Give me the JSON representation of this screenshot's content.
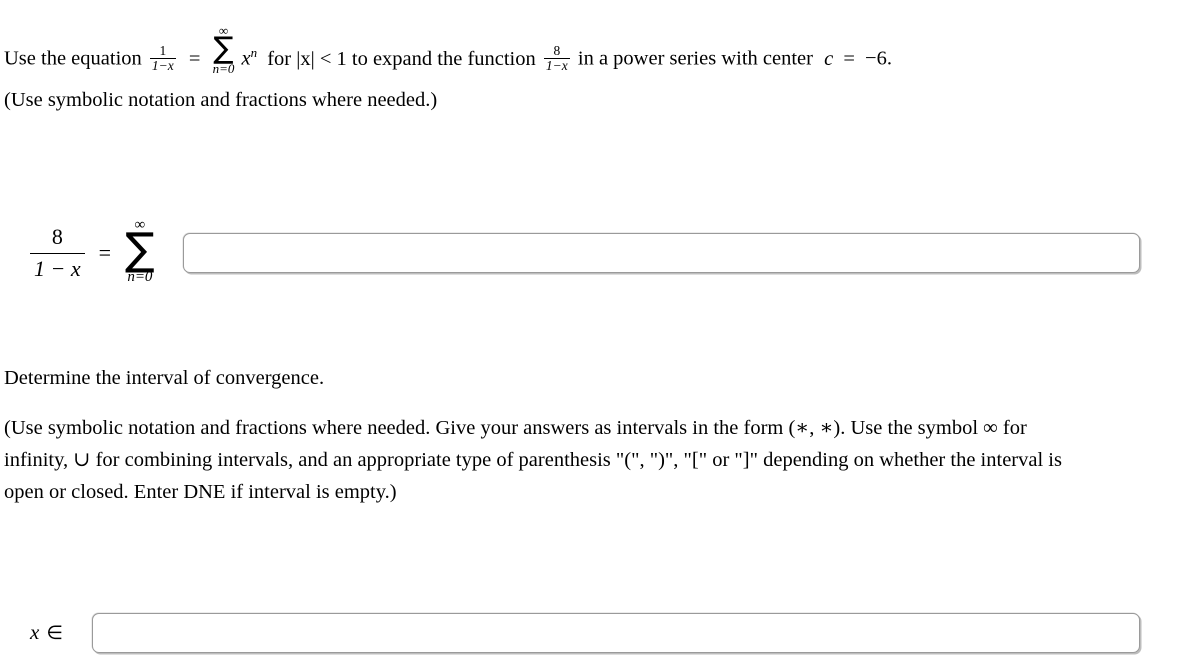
{
  "question": {
    "intro": {
      "before_equation": "Use the equation",
      "identity_fraction": {
        "numerator": "1",
        "denominator": "1−x"
      },
      "equals": "=",
      "sum_upper_limit": "∞",
      "sigma": "∑",
      "sum_lower_limit": "n=0",
      "summand": "x",
      "summand_exponent": "n",
      "after_sum": "for |x| < 1 to expand the function",
      "target_fraction": {
        "numerator": "8",
        "denominator": "1−x"
      },
      "after_function": "in a power series with center",
      "center_variable": "c",
      "center_equals": "=",
      "center_value": "−6."
    },
    "notation_note": "(Use symbolic notation and fractions where needed.)"
  },
  "series_equation": {
    "left_fraction": {
      "numerator": "8",
      "denominator": "1 − x"
    },
    "equals": "=",
    "sum_upper_limit": "∞",
    "sigma": "∑",
    "sum_lower_limit": "n=0",
    "answer_value": "",
    "answer_placeholder": ""
  },
  "interval_section": {
    "heading": "Determine the interval of convergence.",
    "instructions_line_1": "(Use symbolic notation and fractions where needed. Give your answers as intervals in the form (∗, ∗). Use the symbol ∞ for",
    "instructions_line_2": "infinity, ∪ for combining intervals, and an appropriate type of parenthesis \"(\", \")\", \"[\" or \"]\" depending on whether the interval is",
    "instructions_line_3": "open or closed. Enter DNE if interval is empty.)",
    "answer_label_variable": "x",
    "answer_label_operator": "∈",
    "answer_value": "",
    "answer_placeholder": ""
  },
  "colors": {
    "page_background": "#ffffff",
    "text": "#000000",
    "input_border": "#9a9a9a",
    "input_shadow": "#bdbdbd"
  }
}
